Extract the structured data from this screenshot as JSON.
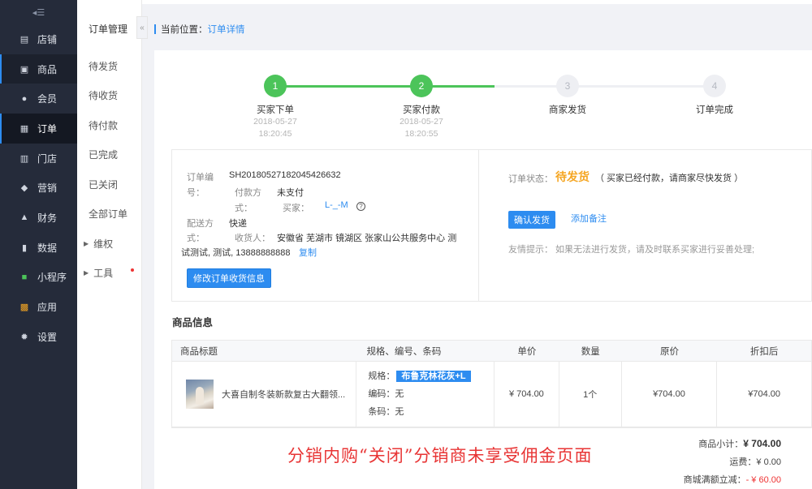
{
  "sidebar": {
    "toggle_icon": "menu-collapse-icon",
    "items": [
      {
        "label": "店铺",
        "icon": "shop-icon"
      },
      {
        "label": "商品",
        "icon": "goods-icon"
      },
      {
        "label": "会员",
        "icon": "member-icon"
      },
      {
        "label": "订单",
        "icon": "order-icon"
      },
      {
        "label": "门店",
        "icon": "store-icon"
      },
      {
        "label": "营销",
        "icon": "marketing-icon"
      },
      {
        "label": "财务",
        "icon": "finance-icon"
      },
      {
        "label": "数据",
        "icon": "data-icon"
      },
      {
        "label": "小程序",
        "icon": "miniprogram-icon"
      },
      {
        "label": "应用",
        "icon": "apps-icon"
      },
      {
        "label": "设置",
        "icon": "settings-icon"
      }
    ]
  },
  "submenu": {
    "title": "订单管理",
    "collapse_glyph": "«",
    "items": [
      "待发货",
      "待收货",
      "待付款",
      "已完成",
      "已关闭",
      "全部订单"
    ],
    "groups": [
      "维权",
      "工具"
    ]
  },
  "breadcrumb": {
    "prefix": "当前位置：",
    "current": "订单详情"
  },
  "steps": [
    {
      "num": "1",
      "label": "买家下单",
      "date": "2018-05-27",
      "time": "18:20:45",
      "state": "done"
    },
    {
      "num": "2",
      "label": "买家付款",
      "date": "2018-05-27",
      "time": "18:20:55",
      "state": "done"
    },
    {
      "num": "3",
      "label": "商家发货",
      "date": "",
      "time": "",
      "state": "todo"
    },
    {
      "num": "4",
      "label": "订单完成",
      "date": "",
      "time": "",
      "state": "todo"
    }
  ],
  "order": {
    "no_label_1": "订单编",
    "no_label_2": "号：",
    "no_value": "SH20180527182045426632",
    "pay_label_1": "付款方",
    "pay_label_2": "式：",
    "pay_value": "未支付",
    "buyer_label": "买家：",
    "buyer_value": "L-_-M",
    "ship_label_1": "配送方",
    "ship_label_2": "式：",
    "ship_value": "快递",
    "receiver_label": "收货人：",
    "receiver_value_1": "安徽省 芜湖市 镜湖区 张家山公共服务中心 测",
    "receiver_value_2": "试测试, 测试, 13888888888",
    "copy_label": "复制",
    "edit_button": "修改订单收货信息"
  },
  "status": {
    "label": "订单状态：",
    "value": "待发货",
    "note": "（ 买家已经付款，请商家尽快发货 ）",
    "confirm_button": "确认发货",
    "remark_link": "添加备注",
    "tip": "友情提示： 如果无法进行发货，请及时联系买家进行妥善处理;"
  },
  "goods": {
    "section_title": "商品信息",
    "headers": [
      "商品标题",
      "规格、编号、条码",
      "单价",
      "数量",
      "原价",
      "折扣后"
    ],
    "rows": [
      {
        "title": "大喜自制冬装新款复古大翻领...",
        "spec_label": "规格：",
        "spec_value": "布鲁克林花灰+L",
        "code_label": "编码：",
        "code_value": "无",
        "barcode_label": "条码：",
        "barcode_value": "无",
        "unit_price": "¥ 704.00",
        "qty": "1个",
        "original": "¥704.00",
        "discounted": "¥704.00"
      }
    ]
  },
  "summary": {
    "subtotal_label": "商品小计：",
    "subtotal_value": "¥ 704.00",
    "shipping_label": "运费：",
    "shipping_value": "¥ 0.00",
    "discount_label": "商城满额立减：",
    "discount_value": "- ¥ 60.00"
  },
  "banner": "分销内购“关闭”分销商未享受佣金页面",
  "colors": {
    "accent": "#2d8cf0",
    "step_done": "#4cc45a",
    "status": "#f5a623",
    "sidebar_bg": "#252b3a",
    "banner": "#e83535"
  }
}
